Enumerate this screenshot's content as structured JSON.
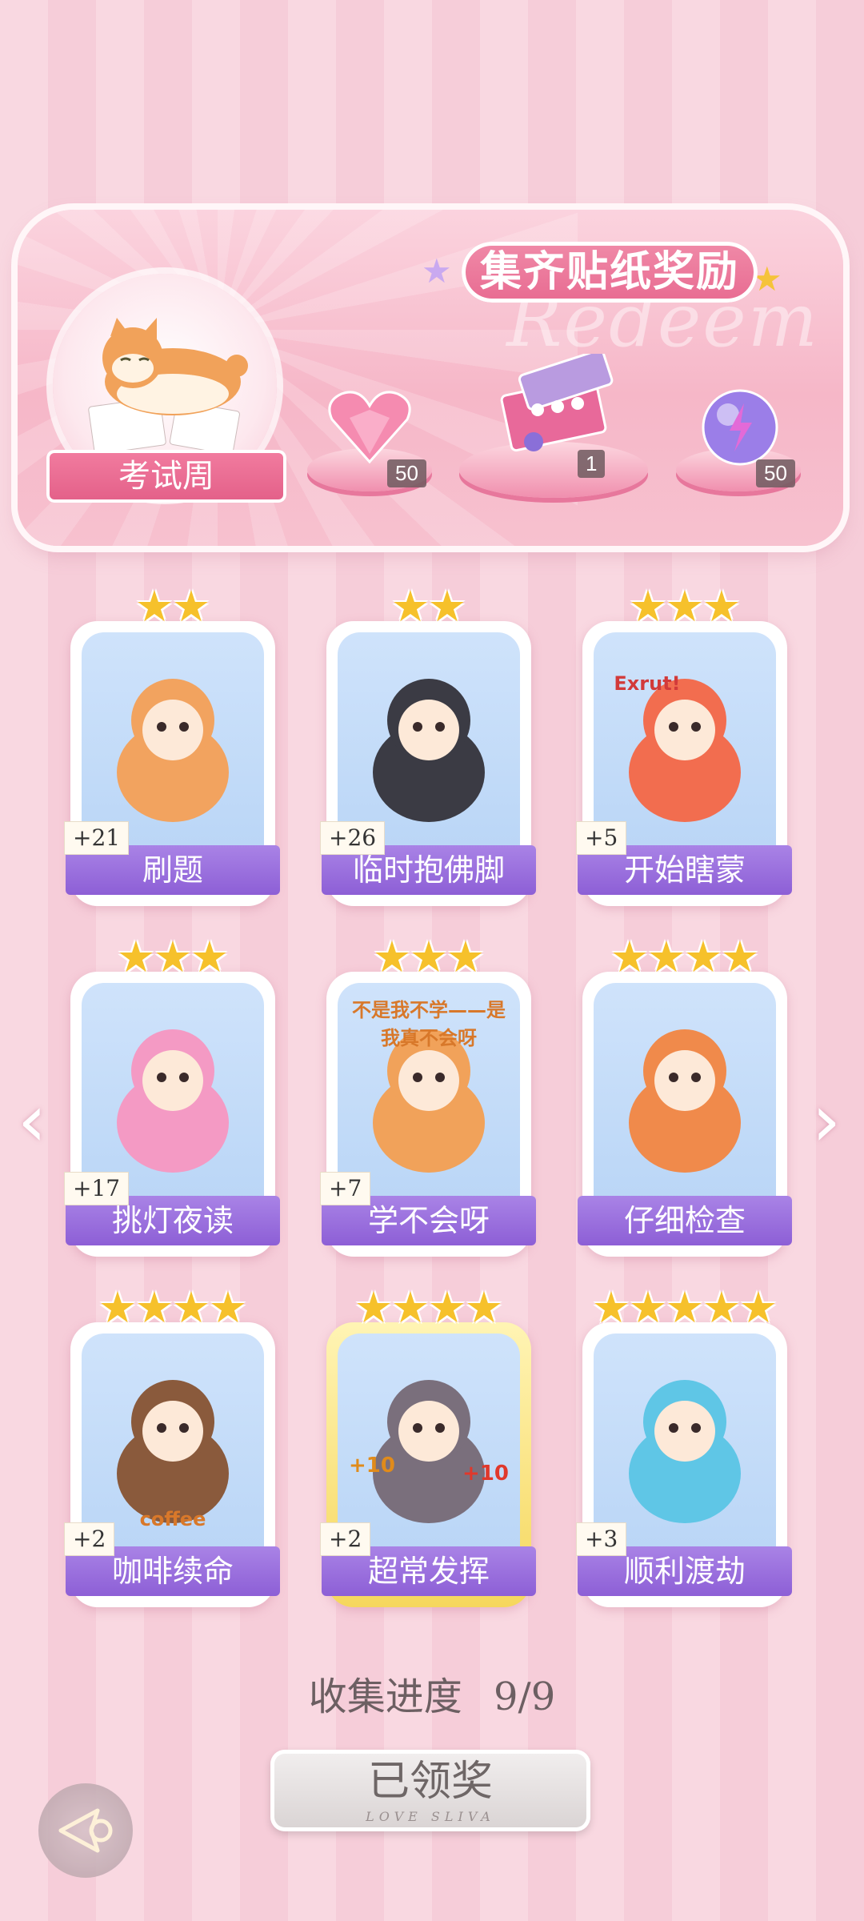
{
  "banner": {
    "title": "集齐贴纸奖励",
    "watermark": "Redeem",
    "emblem_label": "考试周",
    "rewards": [
      {
        "icon": "pink-heart-gem-icon",
        "count": "50"
      },
      {
        "icon": "gift-box-icon",
        "count": "1"
      },
      {
        "icon": "purple-energy-orb-icon",
        "count": "50"
      }
    ]
  },
  "cards": [
    {
      "name": "刷题",
      "count": "+21",
      "stars": 2,
      "art": "orange-cat-writing-icon"
    },
    {
      "name": "临时抱佛脚",
      "count": "+26",
      "stars": 2,
      "art": "girl-reading-icon"
    },
    {
      "name": "开始瞎蒙",
      "count": "+5",
      "stars": 3,
      "art": "shrimp-holding-sign-icon",
      "art_text": "Exrut!"
    },
    {
      "name": "挑灯夜读",
      "count": "+17",
      "stars": 3,
      "art": "pink-hair-girl-desk-icon"
    },
    {
      "name": "学不会呀",
      "count": "+7",
      "stars": 3,
      "art": "shiba-lying-icon",
      "art_text": "不是我不学——是我真不会呀"
    },
    {
      "name": "仔细检查",
      "count": "",
      "stars": 4,
      "art": "girl-magnifier-icon"
    },
    {
      "name": "咖啡续命",
      "count": "+2",
      "stars": 4,
      "art": "bear-coffee-icon",
      "art_text": "coffee"
    },
    {
      "name": "超常发挥",
      "count": "+2",
      "stars": 4,
      "art": "cat-pencils-icon",
      "art_text_left": "+10",
      "art_text_right": "+10"
    },
    {
      "name": "顺利渡劫",
      "count": "+3",
      "stars": 5,
      "art": "blue-hair-girl-pen-icon"
    }
  ],
  "progress": {
    "label": "收集进度",
    "value": "9/9"
  },
  "claim_button": {
    "label": "已领奖",
    "sub": "LOVE SLIVA"
  },
  "colors": {
    "card_label": "#9a6fde",
    "star": "#f6c12b",
    "banner": "#f6b7c8"
  }
}
